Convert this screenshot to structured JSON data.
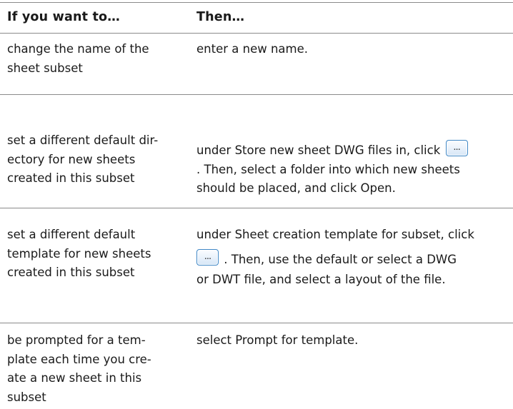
{
  "header": {
    "col1": "If you want to…",
    "col2": "Then…"
  },
  "rows": [
    {
      "if_lines": [
        "change the name of the",
        "sheet subset"
      ],
      "then_lines": [
        "enter a new name."
      ]
    },
    {
      "if_lines": [
        "set a different default dir-",
        "ectory for new sheets",
        "created in this subset"
      ],
      "then_line1": "under Store new sheet DWG files in, click",
      "then_line2": ". Then, select a folder into which new sheets",
      "then_line3": "should be placed, and click Open."
    },
    {
      "if_lines": [
        "set a different default",
        "template for new sheets",
        "created in this subset"
      ],
      "then_line1": "under Sheet creation template for subset, click",
      "then_line2": ". Then, use the default or select a DWG",
      "then_line3": "or DWT file, and select a layout of the file."
    },
    {
      "if_lines": [
        "be prompted for a tem-",
        "plate each time you cre-",
        "ate a new sheet in this",
        "subset"
      ],
      "then_lines": [
        "select Prompt for template."
      ]
    }
  ],
  "icons": {
    "browse_button": "ellipsis-browse-icon",
    "browse_glyph": "..."
  }
}
